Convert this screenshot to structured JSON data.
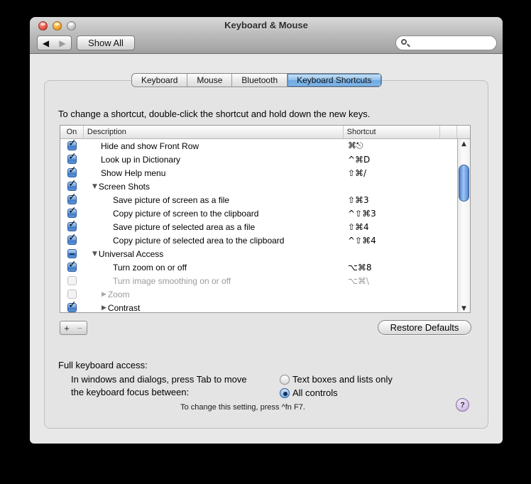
{
  "window": {
    "title": "Keyboard & Mouse",
    "toolbar": {
      "back_glyph": "◀",
      "forward_glyph": "▶",
      "show_all_label": "Show All",
      "search_value": "",
      "search_placeholder": ""
    }
  },
  "tabs": [
    {
      "label": "Keyboard",
      "selected": false
    },
    {
      "label": "Mouse",
      "selected": false
    },
    {
      "label": "Bluetooth",
      "selected": false
    },
    {
      "label": "Keyboard Shortcuts",
      "selected": true
    }
  ],
  "panel": {
    "instruction": "To change a shortcut, double-click the shortcut and hold down the new keys.",
    "table": {
      "columns": {
        "on": "On",
        "description": "Description",
        "shortcut": "Shortcut"
      },
      "rows": [
        {
          "on": "checked",
          "label": "Hide and show Front Row",
          "shortcut": "⌘⎋",
          "type": "item1",
          "dim": false
        },
        {
          "on": "checked",
          "label": "Look up in Dictionary",
          "shortcut": "^⌘D",
          "type": "item1",
          "dim": false
        },
        {
          "on": "checked",
          "label": "Show Help menu",
          "shortcut": "⇧⌘/",
          "type": "item1",
          "dim": false
        },
        {
          "on": "checked",
          "label": "Screen Shots",
          "shortcut": "",
          "type": "group1",
          "disclosure": "expanded",
          "dim": false
        },
        {
          "on": "checked",
          "label": "Save picture of screen as a file",
          "shortcut": "⇧⌘3",
          "type": "item2",
          "dim": false
        },
        {
          "on": "checked",
          "label": "Copy picture of screen to the clipboard",
          "shortcut": "^⇧⌘3",
          "type": "item2",
          "dim": false
        },
        {
          "on": "checked",
          "label": "Save picture of selected area as a file",
          "shortcut": "⇧⌘4",
          "type": "item2",
          "dim": false
        },
        {
          "on": "checked",
          "label": "Copy picture of selected area to the clipboard",
          "shortcut": "^⇧⌘4",
          "type": "item2",
          "dim": false
        },
        {
          "on": "mixed",
          "label": "Universal Access",
          "shortcut": "",
          "type": "group1",
          "disclosure": "expanded",
          "dim": false
        },
        {
          "on": "checked",
          "label": "Turn zoom on or off",
          "shortcut": "⌥⌘8",
          "type": "item2",
          "dim": false
        },
        {
          "on": "unchecked",
          "label": "Turn image smoothing on or off",
          "shortcut": "⌥⌘\\",
          "type": "item2",
          "dim": true
        },
        {
          "on": "unchecked",
          "label": "Zoom",
          "shortcut": "",
          "type": "group2",
          "disclosure": "collapsed",
          "dim": true
        },
        {
          "on": "checked",
          "label": "Contrast",
          "shortcut": "",
          "type": "group2",
          "disclosure": "collapsed",
          "dim": false
        }
      ]
    },
    "add_label": "+",
    "remove_label": "−",
    "restore_defaults_label": "Restore Defaults"
  },
  "footer": {
    "full_keyboard_access_label": "Full keyboard access:",
    "description_line1": "In windows and dialogs, press Tab to move",
    "description_line2": "the keyboard focus between:",
    "radio_options": [
      {
        "label": "Text boxes and lists only",
        "selected": false
      },
      {
        "label": "All controls",
        "selected": true
      }
    ],
    "hint": "To change this setting, press ^fn F7.",
    "help_label": "?"
  },
  "icons": {
    "check": "✓",
    "disclosure_expanded": "▼",
    "disclosure_collapsed": "▶",
    "scroll_up": "▲",
    "scroll_down": "▼"
  },
  "colors": {
    "selected_tab_blue": "#8fc0ea",
    "checkbox_blue": "#4a82cf",
    "scroll_thumb_blue": "#6f9fdd",
    "window_chrome_gray": "#b5b5b5",
    "panel_gray": "#e4e4e4",
    "help_purple": "#8a6fa8"
  }
}
